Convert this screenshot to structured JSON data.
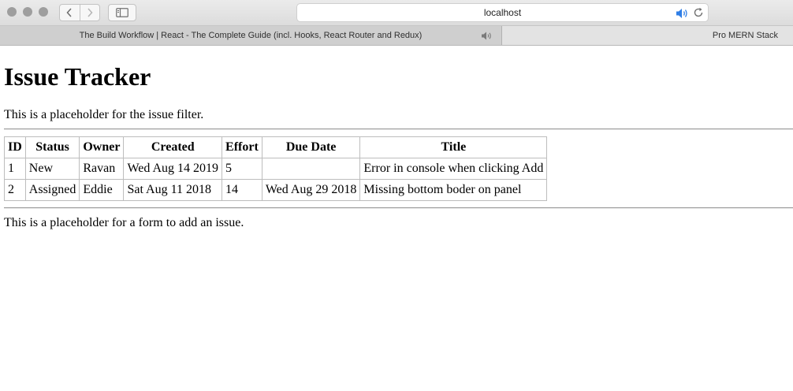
{
  "browser": {
    "url": "localhost",
    "tabs": [
      {
        "label": "The Build Workflow | React - The Complete Guide (incl. Hooks, React Router and Redux)"
      },
      {
        "label": "Pro MERN Stack"
      }
    ],
    "icons": {
      "close": "window-close-icon",
      "minimize": "window-minimize-icon",
      "zoom": "window-zoom-icon",
      "back": "chevron-left-icon",
      "forward": "chevron-right-icon",
      "sidebar": "sidebar-icon",
      "audio": "speaker-icon",
      "reload": "reload-icon"
    },
    "accent_color": "#2f7ee6"
  },
  "page": {
    "title": "Issue Tracker",
    "filter_placeholder": "This is a placeholder for the issue filter.",
    "add_placeholder": "This is a placeholder for a form to add an issue.",
    "table": {
      "headers": [
        "ID",
        "Status",
        "Owner",
        "Created",
        "Effort",
        "Due Date",
        "Title"
      ],
      "rows": [
        [
          "1",
          "New",
          "Ravan",
          "Wed Aug 14 2019",
          "5",
          "",
          "Error in console when clicking Add"
        ],
        [
          "2",
          "Assigned",
          "Eddie",
          "Sat Aug 11 2018",
          "14",
          "Wed Aug 29 2018",
          "Missing bottom boder on panel"
        ]
      ]
    }
  }
}
